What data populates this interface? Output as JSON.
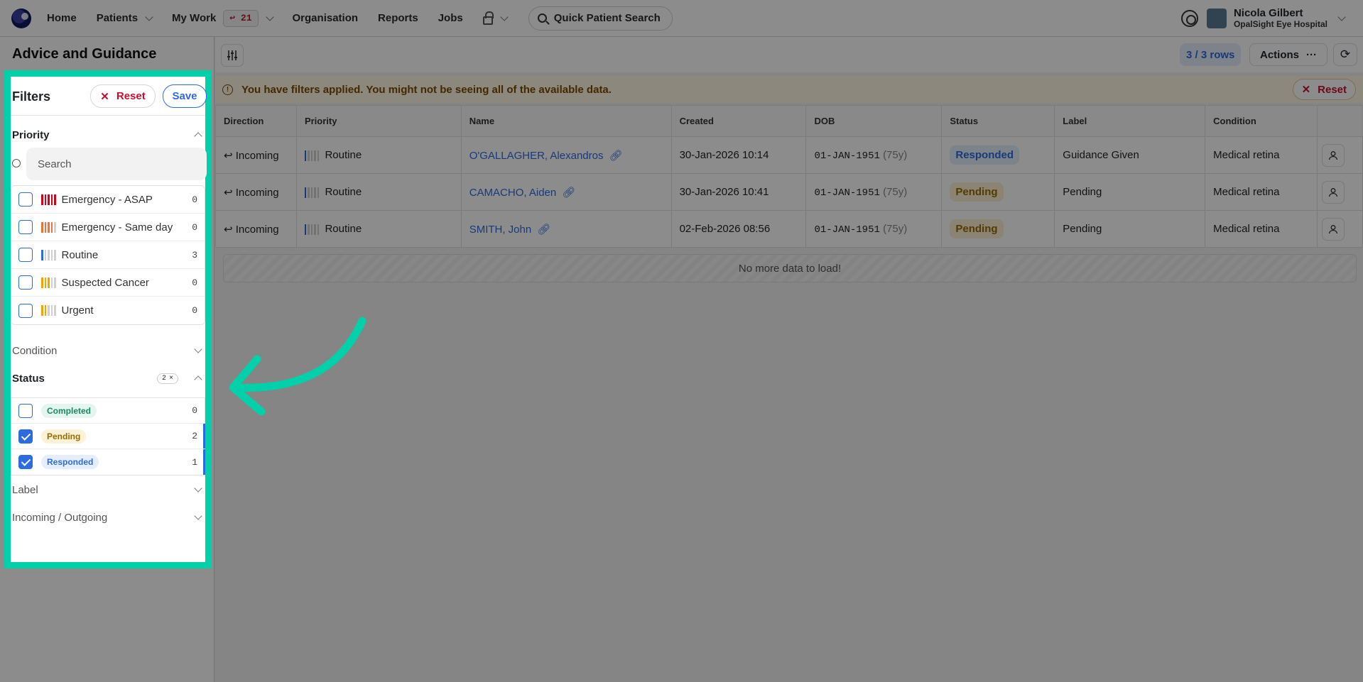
{
  "topbar": {
    "nav": [
      {
        "label": "Home"
      },
      {
        "label": "Patients"
      },
      {
        "label": "My Work"
      },
      {
        "label": "Organisation"
      },
      {
        "label": "Reports"
      },
      {
        "label": "Jobs"
      }
    ],
    "mywork_badge": "↩ 21",
    "quick_search": "Quick Patient Search",
    "user_name": "Nicola Gilbert",
    "user_org": "OpalSight Eye Hospital"
  },
  "page": {
    "title": "Advice and Guidance"
  },
  "filters": {
    "title": "Filters",
    "reset_label": "Reset",
    "save_label": "Save",
    "priority": {
      "label": "Priority",
      "search_placeholder": "Search",
      "options": [
        {
          "label": "Emergency - ASAP",
          "count": "0",
          "checked": false,
          "bar_color": "#d0021b",
          "bar_fill": 5
        },
        {
          "label": "Emergency - Same day",
          "count": "0",
          "checked": false,
          "bar_color": "#f0703a",
          "bar_fill": 4
        },
        {
          "label": "Routine",
          "count": "3",
          "checked": false,
          "bar_color": "#2d6be0",
          "bar_fill": 1
        },
        {
          "label": "Suspected Cancer",
          "count": "0",
          "checked": false,
          "bar_color": "#f0a500",
          "bar_fill": 3
        },
        {
          "label": "Urgent",
          "count": "0",
          "checked": false,
          "bar_color": "#f0a500",
          "bar_fill": 2
        }
      ]
    },
    "condition": {
      "label": "Condition"
    },
    "status": {
      "label": "Status",
      "selected_count": "2",
      "options": [
        {
          "label": "Completed",
          "count": "0",
          "checked": false,
          "chip_bg": "#e2f5ee",
          "chip_fg": "#1a8a63"
        },
        {
          "label": "Pending",
          "count": "2",
          "checked": true,
          "chip_bg": "#fdf1d6",
          "chip_fg": "#9a6b00"
        },
        {
          "label": "Responded",
          "count": "1",
          "checked": true,
          "chip_bg": "#e4eefc",
          "chip_fg": "#2d6be0"
        }
      ]
    },
    "label": {
      "label": "Label"
    },
    "incoming_outgoing": {
      "label": "Incoming / Outgoing"
    }
  },
  "toolbar": {
    "rows_badge": "3 / 3 rows",
    "actions_label": "Actions",
    "actions_more": "···"
  },
  "banner": {
    "text": "You have filters applied. You might not be seeing all of the available data.",
    "reset_label": "Reset"
  },
  "table": {
    "columns": [
      "Direction",
      "Priority",
      "Name",
      "Created",
      "DOB",
      "Status",
      "Label",
      "Condition"
    ],
    "rows": [
      {
        "direction": "Incoming",
        "priority": "Routine",
        "name": "O'GALLAGHER, Alexandros",
        "created": "30-Jan-2026 10:14",
        "dob": "01-JAN-1951",
        "age": "(75y)",
        "status": "Responded",
        "status_kind": "responded",
        "label": "Guidance Given",
        "condition": "Medical retina"
      },
      {
        "direction": "Incoming",
        "priority": "Routine",
        "name": "CAMACHO, Aiden",
        "created": "30-Jan-2026 10:41",
        "dob": "01-JAN-1951",
        "age": "(75y)",
        "status": "Pending",
        "status_kind": "pending",
        "label": "Pending",
        "condition": "Medical retina"
      },
      {
        "direction": "Incoming",
        "priority": "Routine",
        "name": "SMITH, John",
        "created": "02-Feb-2026 08:56",
        "dob": "01-JAN-1951",
        "age": "(75y)",
        "status": "Pending",
        "status_kind": "pending",
        "label": "Pending",
        "condition": "Medical retina"
      }
    ],
    "footer": "No more data to load!"
  },
  "colors": {
    "highlight": "#00d1aa",
    "accent": "#2d6be0",
    "danger": "#c8102e"
  }
}
